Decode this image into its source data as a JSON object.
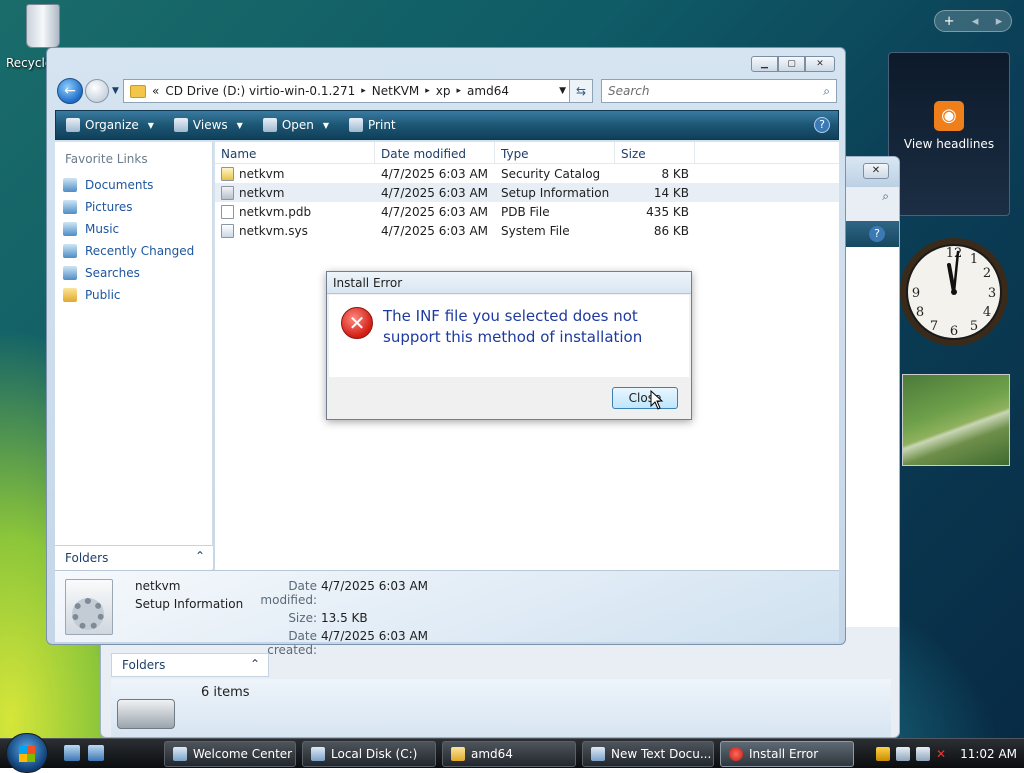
{
  "desktop": {
    "recycle_label": "Recycle"
  },
  "sidebar": {
    "feed_label": "View headlines"
  },
  "explorer": {
    "breadcrumb": {
      "prefix": "«",
      "parts": [
        "CD Drive (D:) virtio-win-0.1.271",
        "NetKVM",
        "xp",
        "amd64"
      ],
      "sep": "▸"
    },
    "search_placeholder": "Search",
    "toolbar": {
      "organize": "Organize",
      "views": "Views",
      "open": "Open",
      "print": "Print",
      "help": "?"
    },
    "nav": {
      "header": "Favorite Links",
      "items": [
        "Documents",
        "Pictures",
        "Music",
        "Recently Changed",
        "Searches",
        "Public"
      ]
    },
    "folders_label": "Folders",
    "columns": [
      "Name",
      "Date modified",
      "Type",
      "Size"
    ],
    "files": [
      {
        "name": "netkvm",
        "date": "4/7/2025 6:03 AM",
        "type": "Security Catalog",
        "size": "8 KB"
      },
      {
        "name": "netkvm",
        "date": "4/7/2025 6:03 AM",
        "type": "Setup Information",
        "size": "14 KB"
      },
      {
        "name": "netkvm.pdb",
        "date": "4/7/2025 6:03 AM",
        "type": "PDB File",
        "size": "435 KB"
      },
      {
        "name": "netkvm.sys",
        "date": "4/7/2025 6:03 AM",
        "type": "System File",
        "size": "86 KB"
      }
    ],
    "details": {
      "name": "netkvm",
      "type": "Setup Information",
      "date_modified_label": "Date modified:",
      "date_modified": "4/7/2025 6:03 AM",
      "size_label": "Size:",
      "size": "13.5 KB",
      "date_created_label": "Date created:",
      "date_created": "4/7/2025 6:03 AM"
    }
  },
  "back_window": {
    "folders_label": "Folders",
    "items_count": "6 items"
  },
  "dialog": {
    "title": "Install Error",
    "message": "The INF file you selected does not support this method of installation",
    "close_label": "Close"
  },
  "taskbar": {
    "buttons": [
      "Welcome Center",
      "Local Disk (C:)",
      "amd64",
      "New Text Docu...",
      "Install Error"
    ],
    "time": "11:02 AM"
  }
}
